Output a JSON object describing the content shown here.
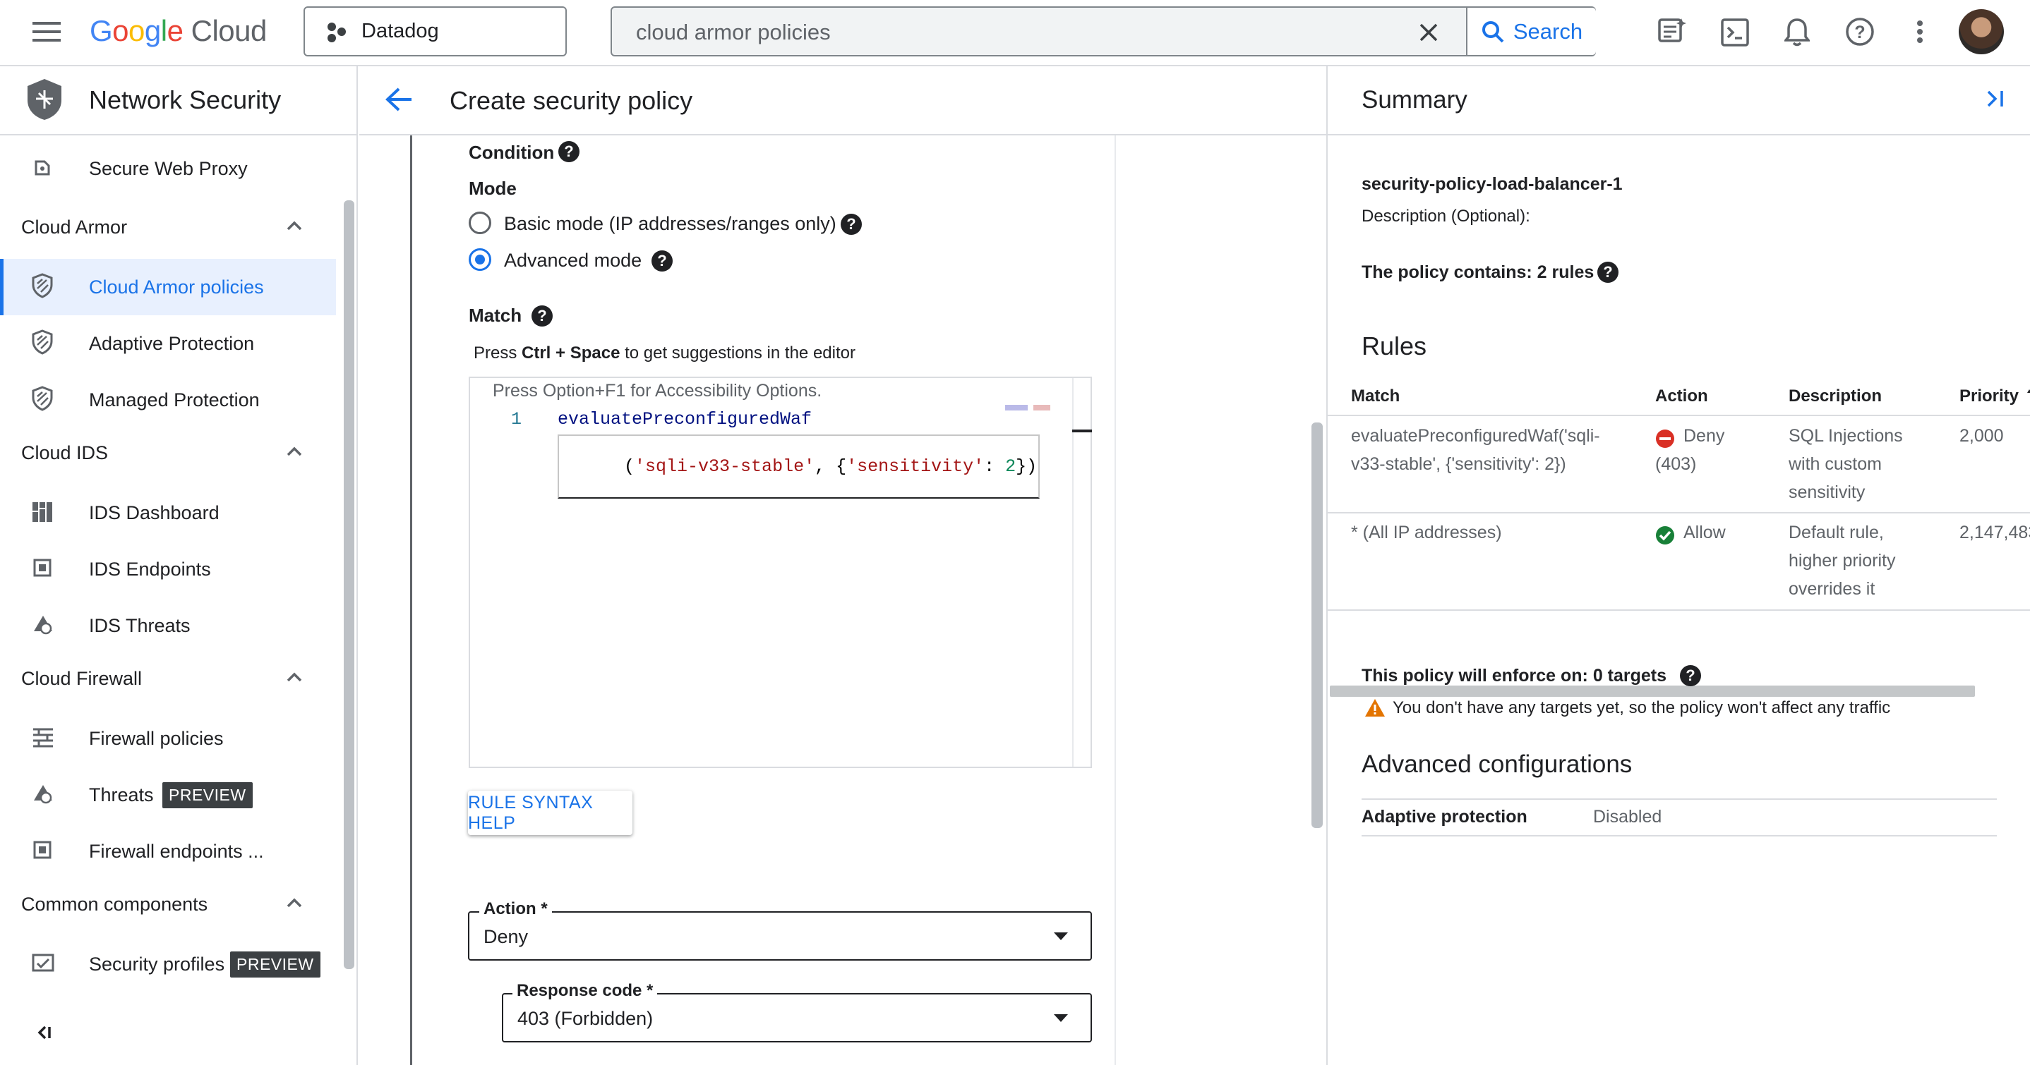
{
  "topbar": {
    "brand": "Google Cloud",
    "project": "Datadog",
    "search_value": "cloud armor policies",
    "search_button": "Search",
    "icons": [
      "menu-icon",
      "notes-icon",
      "terminal-icon",
      "bell-icon",
      "help-icon",
      "more-vert-icon",
      "avatar"
    ]
  },
  "leftnav": {
    "title": "Network Security",
    "items": [
      {
        "label": "Secure Web Proxy"
      },
      {
        "section": "Cloud Armor"
      },
      {
        "label": "Cloud Armor policies",
        "active": true
      },
      {
        "label": "Adaptive Protection"
      },
      {
        "label": "Managed Protection"
      },
      {
        "section": "Cloud IDS"
      },
      {
        "label": "IDS Dashboard"
      },
      {
        "label": "IDS Endpoints"
      },
      {
        "label": "IDS Threats"
      },
      {
        "section": "Cloud Firewall"
      },
      {
        "label": "Firewall policies"
      },
      {
        "label": "Threats",
        "badge": "PREVIEW"
      },
      {
        "label": "Firewall endpoints ..."
      },
      {
        "section": "Common components"
      },
      {
        "label": "Security profiles",
        "badge": "PREVIEW"
      }
    ],
    "collapse_icon": "<I"
  },
  "main": {
    "title": "Create security policy",
    "condition_label": "Condition",
    "mode_label": "Mode",
    "mode_options": [
      "Basic mode (IP addresses/ranges only)",
      "Advanced mode"
    ],
    "mode_selected": "Advanced mode",
    "match_label": "Match",
    "hint_prefix": "Press ",
    "hint_keys": "Ctrl + Space",
    "hint_suffix": " to get suggestions in the editor",
    "editor": {
      "accessibility_hint": "Press Option+F1 for Accessibility Options.",
      "line_number": "1",
      "line1": "evaluatePreconfiguredWaf",
      "line2_open": "(",
      "line2_str1": "'sqli-v33-stable'",
      "line2_mid": ", {",
      "line2_str2": "'sensitivity'",
      "line2_colon": ": ",
      "line2_num": "2",
      "line2_close": "})"
    },
    "rule_syntax_button": "RULE SYNTAX HELP",
    "action": {
      "label": "Action *",
      "value": "Deny"
    },
    "response_code": {
      "label": "Response code *",
      "value": "403 (Forbidden)"
    }
  },
  "summary": {
    "title": "Summary",
    "policy_name": "security-policy-load-balancer-1",
    "description": "Description (Optional):",
    "rules_count_text": "The policy contains: 2 rules",
    "rules_heading": "Rules",
    "columns": [
      "Match",
      "Action",
      "Description",
      "Priority"
    ],
    "rows": [
      {
        "match": [
          "evaluatePreconfiguredWaf('sqli-",
          "v33-stable', {'sensitivity': 2})"
        ],
        "action": [
          "Deny",
          "(403)"
        ],
        "action_type": "deny",
        "description": [
          "SQL Injections",
          "with custom",
          "sensitivity"
        ],
        "priority": "2,000"
      },
      {
        "match": [
          "* (All IP addresses)"
        ],
        "action": [
          "Allow"
        ],
        "action_type": "allow",
        "description": [
          "Default rule,",
          "higher priority",
          "overrides it"
        ],
        "priority": "2,147,483"
      }
    ],
    "enforce_text": "This policy will enforce on: 0 targets",
    "warning_text": "You don't have any targets yet, so the policy won't affect any traffic",
    "advanced_heading": "Advanced configurations",
    "adaptive_label": "Adaptive protection",
    "adaptive_value": "Disabled"
  },
  "colors": {
    "accent": "#1a73e8",
    "active_bg": "#e8f0fe",
    "deny": "#d93025",
    "allow": "#188038",
    "warning": "#e37400",
    "badge_bg": "#3c4043"
  }
}
